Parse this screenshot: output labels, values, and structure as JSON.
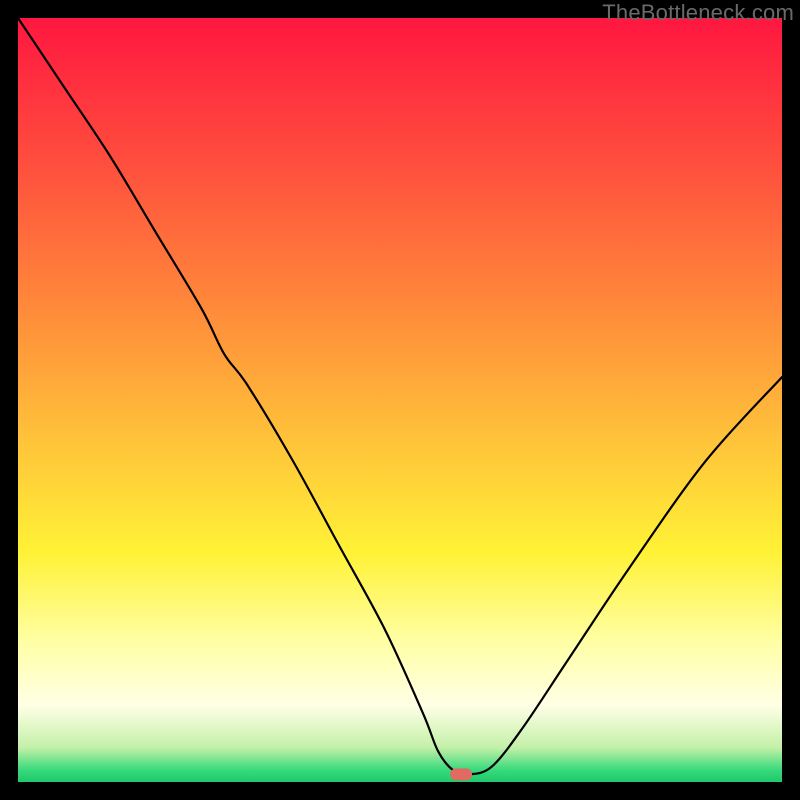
{
  "watermark": "TheBottleneck.com",
  "chart_data": {
    "type": "line",
    "title": "",
    "xlabel": "",
    "ylabel": "",
    "xlim": [
      0,
      100
    ],
    "ylim": [
      0,
      100
    ],
    "series": [
      {
        "name": "bottleneck-curve",
        "x": [
          0,
          6,
          12,
          18,
          24,
          27,
          30,
          36,
          42,
          48,
          53,
          55,
          57,
          59,
          62,
          66,
          72,
          80,
          90,
          100
        ],
        "y": [
          100,
          91,
          82,
          72,
          62,
          56,
          52,
          42,
          31,
          20,
          9,
          4,
          1.5,
          1,
          2,
          7,
          16,
          28,
          42,
          53
        ]
      }
    ],
    "marker": {
      "x": 58,
      "y": 1,
      "color": "#e16a63"
    },
    "gradient_stops": [
      {
        "offset": 0.0,
        "color": "#ff1740"
      },
      {
        "offset": 0.18,
        "color": "#ff4b3e"
      },
      {
        "offset": 0.38,
        "color": "#ff8a3a"
      },
      {
        "offset": 0.55,
        "color": "#ffc23a"
      },
      {
        "offset": 0.7,
        "color": "#fff236"
      },
      {
        "offset": 0.82,
        "color": "#ffffa8"
      },
      {
        "offset": 0.9,
        "color": "#ffffe6"
      },
      {
        "offset": 0.955,
        "color": "#c3f0a8"
      },
      {
        "offset": 0.985,
        "color": "#35d97b"
      },
      {
        "offset": 1.0,
        "color": "#1fc96b"
      }
    ]
  }
}
